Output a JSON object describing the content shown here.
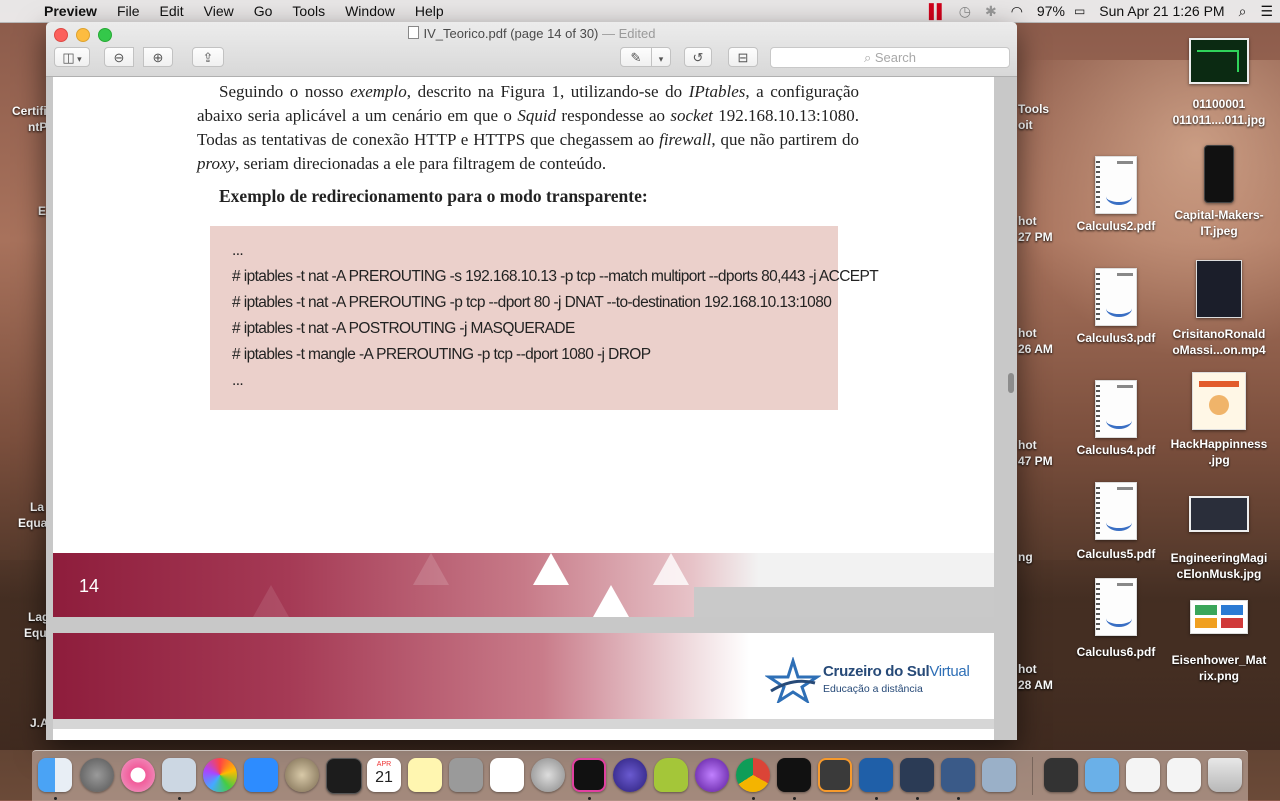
{
  "menubar": {
    "apple": "",
    "app_name": "Preview",
    "menus": [
      "File",
      "Edit",
      "View",
      "Go",
      "Tools",
      "Window",
      "Help"
    ],
    "status": {
      "battery": "97%",
      "datetime": "Sun Apr 21  1:26 PM"
    }
  },
  "window": {
    "title": "IV_Teorico.pdf (page 14 of 30)",
    "edited": "— Edited",
    "search_placeholder": "Search"
  },
  "document": {
    "paragraph": {
      "s1": "Seguindo o nosso ",
      "s1i": "exemplo",
      "s2": ", descrito na Figura 1, utilizando-se do ",
      "s2i": "IPtables",
      "s3": ", a configuração abaixo seria aplicável a um cenário em que o ",
      "s3i": "Squid",
      "s4": " respondesse ao ",
      "s4i": "socket",
      "s5": " 192.168.10.13:1080. Todas as tentativas de conexão HTTP e HTTPS que chegassem ao ",
      "s5i": "firewall",
      "s6": ", que não partirem do ",
      "s6i": "proxy",
      "s7": ", seriam direcionadas a ele para filtragem de conteúdo."
    },
    "heading": "Exemplo de redirecionamento para o modo transparente:",
    "code_lines": [
      "...",
      "# iptables -t nat -A PREROUTING -s 192.168.10.13 -p tcp --match multiport --dports 80,443 -j ACCEPT",
      "# iptables -t nat -A PREROUTING -p tcp --dport 80 -j DNAT --to-destination 192.168.10.13:1080",
      "# iptables -t nat -A POSTROUTING -j MASQUERADE",
      "# iptables -t mangle -A PREROUTING -p tcp --dport 1080 -j DROP",
      "..."
    ],
    "page_number": "14",
    "logo": {
      "brand_main": "Cruzeiro do Sul",
      "brand_virtual": "Virtual",
      "tagline": "Educação a distância"
    }
  },
  "desktop": {
    "icons": [
      {
        "label": "01100001\n011011....011.jpg"
      },
      {
        "label": "Calculus2.pdf"
      },
      {
        "label": "Capital-Makers-\nIT.jpeg"
      },
      {
        "label": "Calculus3.pdf"
      },
      {
        "label": "CrisitanoRonald\noMassi...on.mp4"
      },
      {
        "label": "Calculus4.pdf"
      },
      {
        "label": "HackHappinness\n.jpg"
      },
      {
        "label": "Calculus5.pdf"
      },
      {
        "label": "EngineeringMagi\ncElonMusk.jpg"
      },
      {
        "label": "Calculus6.pdf"
      },
      {
        "label": "Eisenhower_Mat\nrix.png"
      }
    ],
    "left_fragments": [
      "Certifi",
      "ntP",
      "E",
      "La",
      "Equa",
      "Lag",
      "Equ",
      "J.A"
    ],
    "peek_fragments": [
      "Tools",
      "oit",
      "hot",
      "27 PM",
      "hot",
      "26 AM",
      "hot",
      "47 PM",
      "ng",
      "hot",
      "28 AM"
    ],
    "dock_calendar": {
      "month": "APR",
      "day": "21"
    }
  }
}
